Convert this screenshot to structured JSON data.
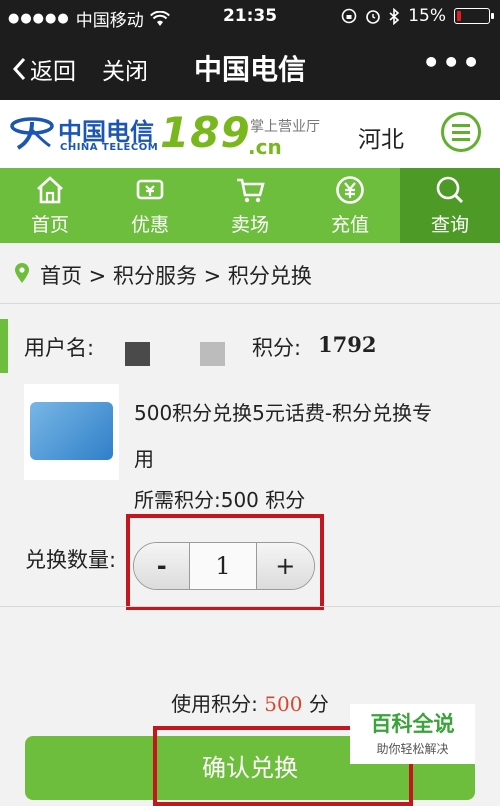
{
  "status_bar": {
    "carrier": "中国移动",
    "time": "21:35",
    "battery": "15%",
    "battery_level": 0.15
  },
  "navbar": {
    "back_label": "返回",
    "close_label": "关闭",
    "title": "中国电信",
    "more_label": "•••"
  },
  "header": {
    "logo_cn": "中国电信",
    "logo_en": "CHINA TELECOM",
    "logo_189": "189",
    "logo_subtitle": "掌上营业厅",
    "logo_cn_domain": ".cn",
    "region": "河北"
  },
  "tabs": [
    {
      "label": "首页",
      "icon": "home-icon"
    },
    {
      "label": "优惠",
      "icon": "discount-icon"
    },
    {
      "label": "卖场",
      "icon": "cart-icon"
    },
    {
      "label": "充值",
      "icon": "yuan-icon"
    },
    {
      "label": "查询",
      "icon": "search-icon",
      "active": true
    }
  ],
  "breadcrumb": "首页 > 积分服务 > 积分兑换",
  "user": {
    "username_label": "用户名:",
    "points_label": "积分:",
    "points_value": "1792"
  },
  "product": {
    "name": "500积分兑换5元话费-积分兑换专用",
    "required_points": "所需积分:500 积分"
  },
  "quantity": {
    "label": "兑换数量:",
    "minus": "-",
    "value": "1",
    "plus": "+"
  },
  "usage": {
    "label": "使用积分:",
    "value": "500",
    "unit": "分"
  },
  "confirm_label": "确认兑换",
  "watermark": {
    "title": "百科全说",
    "subtitle": "助你轻松解决"
  },
  "colors": {
    "green": "#6ebe3d",
    "dark_green": "#4e9a26",
    "highlight_red": "#c6161d",
    "points_red": "#d9472b"
  }
}
